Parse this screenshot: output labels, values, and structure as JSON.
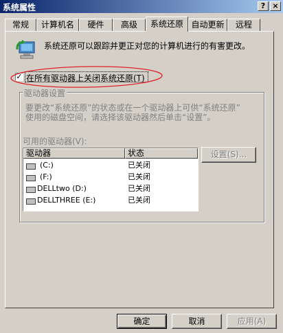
{
  "window": {
    "title": "系统属性",
    "help_btn": "?",
    "close_btn": "×"
  },
  "tabs": [
    {
      "label": "常规"
    },
    {
      "label": "计算机名"
    },
    {
      "label": "硬件"
    },
    {
      "label": "高级"
    },
    {
      "label": "系统还原",
      "active": true
    },
    {
      "label": "自动更新"
    },
    {
      "label": "远程"
    }
  ],
  "intro": {
    "text": "系统还原可以跟踪并更正对您的计算机进行的有害更改。"
  },
  "disable_checkbox": {
    "label": "在所有驱动器上关闭系统还原(T)",
    "checked": true,
    "check_glyph": "✓"
  },
  "drive_settings": {
    "group_label": "驱动器设置",
    "desc_line1": "要更改“系统还原”的状态或在一个驱动器上可供“系统还原”",
    "desc_line2": "使用的磁盘空间，请选择该驱动器然后单击“设置”。",
    "available_label": "可用的驱动器(V):",
    "columns": [
      "驱动器",
      "状态"
    ],
    "drives": [
      {
        "name": "(C:)",
        "status": "已关闭"
      },
      {
        "name": "(F:)",
        "status": "已关闭"
      },
      {
        "name": "DELLtwo (D:)",
        "status": "已关闭"
      },
      {
        "name": "DELLTHREE (E:)",
        "status": "已关闭"
      }
    ],
    "settings_button": "设置(S)..."
  },
  "footer": {
    "ok": "确定",
    "cancel": "取消",
    "apply": "应用(A)"
  },
  "colors": {
    "annotation": "#e0202a",
    "titlebar": "#0a246a"
  }
}
